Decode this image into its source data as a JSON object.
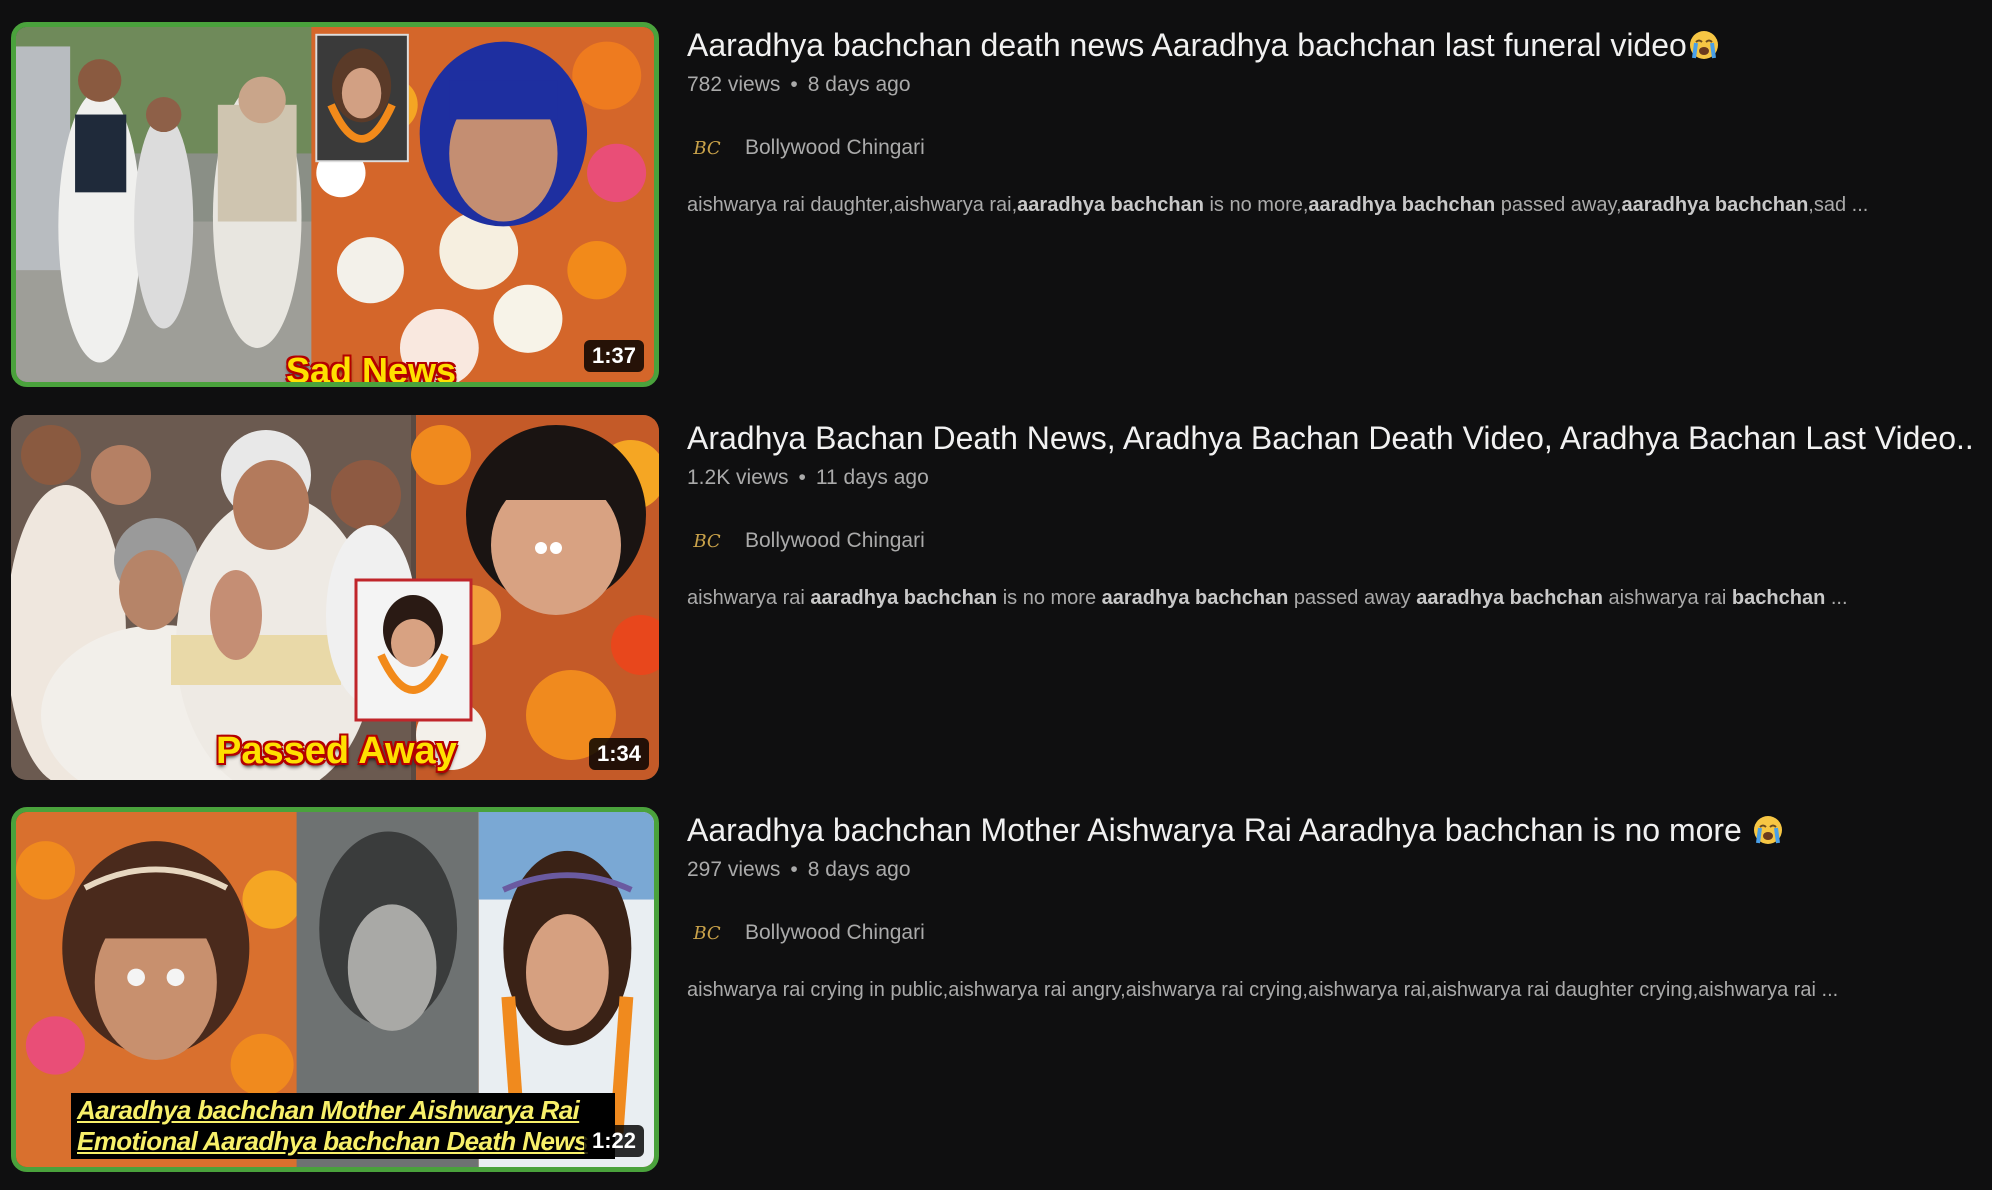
{
  "results": [
    {
      "title": "Aaradhya bachchan death news Aaradhya bachchan last funeral video",
      "title_emoji": "loudly-crying-face-emoji",
      "views": "782 views",
      "age": "8 days ago",
      "channel": "Bollywood Chingari",
      "duration": "1:37",
      "thumbnail_text": "Sad News",
      "description": [
        {
          "t": "aishwarya rai daughter,aishwarya rai,",
          "b": false
        },
        {
          "t": "aaradhya bachchan",
          "b": true
        },
        {
          "t": " is no more,",
          "b": false
        },
        {
          "t": "aaradhya bachchan",
          "b": true
        },
        {
          "t": " passed away,",
          "b": false
        },
        {
          "t": "aaradhya bachchan",
          "b": true
        },
        {
          "t": ",sad ...",
          "b": false
        }
      ]
    },
    {
      "title": "Aradhya Bachan Death News, Aradhya Bachan Death Video, Aradhya Bachan Last Video..",
      "views": "1.2K views",
      "age": "11 days ago",
      "channel": "Bollywood Chingari",
      "duration": "1:34",
      "thumbnail_text": "Passed Away",
      "description": [
        {
          "t": "aishwarya rai ",
          "b": false
        },
        {
          "t": "aaradhya bachchan",
          "b": true
        },
        {
          "t": " is no more ",
          "b": false
        },
        {
          "t": "aaradhya bachchan",
          "b": true
        },
        {
          "t": " passed away ",
          "b": false
        },
        {
          "t": "aaradhya bachchan",
          "b": true
        },
        {
          "t": " aishwarya rai ",
          "b": false
        },
        {
          "t": "bachchan",
          "b": true
        },
        {
          "t": " ...",
          "b": false
        }
      ]
    },
    {
      "title": "Aaradhya bachchan Mother Aishwarya Rai Aaradhya bachchan is no more",
      "title_emoji": "loudly-crying-face-emoji",
      "views": "297 views",
      "age": "8 days ago",
      "channel": "Bollywood Chingari",
      "duration": "1:22",
      "thumbnail_caption": [
        "Aaradhya bachchan Mother Aishwarya Rai",
        "Emotional Aaradhya bachchan Death News"
      ],
      "description": [
        {
          "t": "aishwarya rai crying in public,aishwarya rai angry,aishwarya rai crying,aishwarya rai,aishwarya rai daughter crying,aishwarya rai ...",
          "b": false
        }
      ]
    }
  ],
  "channel_logo_text": "BC",
  "meta_separator": "•",
  "colors": {
    "background": "#0f0f10",
    "title": "#f1f1f1",
    "secondary_text": "#aaaaaa",
    "thumbnail_border": "#4aa23c",
    "overlay_text": "#ffe000",
    "caption_text": "#f8f06a"
  }
}
